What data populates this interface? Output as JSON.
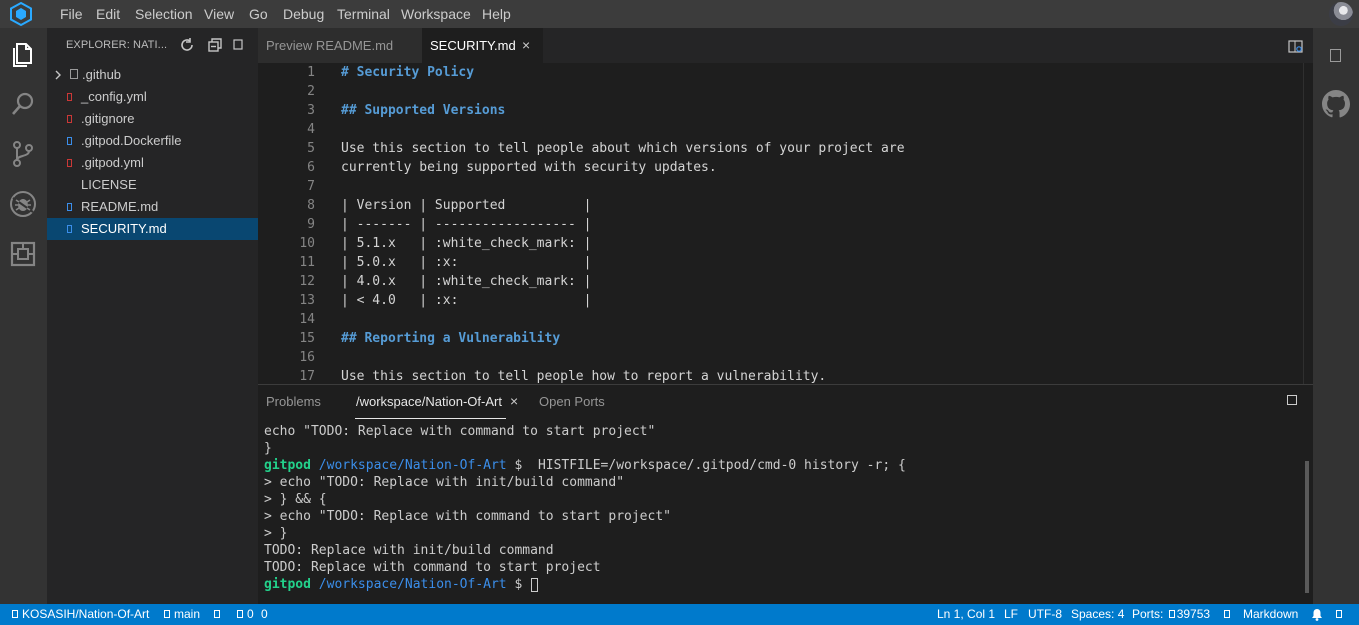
{
  "menu": [
    "File",
    "Edit",
    "Selection",
    "View",
    "Go",
    "Debug",
    "Terminal",
    "Workspace",
    "Help"
  ],
  "activity_icons": [
    "files-icon",
    "search-icon",
    "source-control-icon",
    "debug-icon",
    "extensions-icon"
  ],
  "explorer": {
    "title": "EXPLORER: NATI...",
    "items": [
      {
        "label": ".github",
        "type": "folder"
      },
      {
        "label": "_config.yml",
        "type": "file"
      },
      {
        "label": ".gitignore",
        "type": "file"
      },
      {
        "label": ".gitpod.Dockerfile",
        "type": "file"
      },
      {
        "label": ".gitpod.yml",
        "type": "file"
      },
      {
        "label": "LICENSE",
        "type": "file"
      },
      {
        "label": "README.md",
        "type": "file"
      },
      {
        "label": "SECURITY.md",
        "type": "file",
        "selected": true
      }
    ]
  },
  "tabs": [
    {
      "label": "Preview README.md",
      "active": false
    },
    {
      "label": "SECURITY.md",
      "active": true,
      "close": "×"
    }
  ],
  "editor": {
    "lines": [
      {
        "n": "1",
        "text": "# Security Policy",
        "heading": true
      },
      {
        "n": "2",
        "text": ""
      },
      {
        "n": "3",
        "text": "## Supported Versions",
        "heading": true
      },
      {
        "n": "4",
        "text": ""
      },
      {
        "n": "5",
        "text": "Use this section to tell people about which versions of your project are"
      },
      {
        "n": "6",
        "text": "currently being supported with security updates."
      },
      {
        "n": "7",
        "text": ""
      },
      {
        "n": "8",
        "text": "| Version | Supported          |"
      },
      {
        "n": "9",
        "text": "| ------- | ------------------ |"
      },
      {
        "n": "10",
        "text": "| 5.1.x   | :white_check_mark: |"
      },
      {
        "n": "11",
        "text": "| 5.0.x   | :x:                |"
      },
      {
        "n": "12",
        "text": "| 4.0.x   | :white_check_mark: |"
      },
      {
        "n": "13",
        "text": "| < 4.0   | :x:                |"
      },
      {
        "n": "14",
        "text": ""
      },
      {
        "n": "15",
        "text": "## Reporting a Vulnerability",
        "heading": true
      },
      {
        "n": "16",
        "text": ""
      },
      {
        "n": "17",
        "text": "Use this section to tell people how to report a vulnerability."
      }
    ]
  },
  "panel": {
    "tabs": [
      "Problems",
      "/workspace/Nation-Of-Art",
      "Open Ports"
    ],
    "close": "×"
  },
  "terminal": {
    "lines": [
      {
        "text": "echo \"TODO: Replace with command to start project\""
      },
      {
        "text": "}"
      },
      {
        "user": "gitpod",
        "path": "/workspace/Nation-Of-Art",
        "text": " $  HISTFILE=/workspace/.gitpod/cmd-0 history -r; {"
      },
      {
        "text": "> echo \"TODO: Replace with init/build command\""
      },
      {
        "text": "> } && {"
      },
      {
        "text": "> echo \"TODO: Replace with command to start project\""
      },
      {
        "text": "> }"
      },
      {
        "text": "TODO: Replace with init/build command"
      },
      {
        "text": "TODO: Replace with command to start project"
      },
      {
        "user": "gitpod",
        "path": "/workspace/Nation-Of-Art",
        "text": " $ "
      }
    ]
  },
  "status": {
    "repo": "KOSASIH/Nation-Of-Art",
    "branch": "main",
    "problems": "0",
    "warnings": "0",
    "position": "Ln 1, Col 1",
    "eol": "LF",
    "encoding": "UTF-8",
    "spaces": "Spaces: 4",
    "ports_label": "Ports:",
    "ports_value": "39753",
    "language": "Markdown"
  },
  "colors": {
    "statusbar": "#007acc",
    "selection": "#094771",
    "heading": "#569cd6",
    "prompt_user": "#23d18b",
    "prompt_path": "#3b8eea"
  }
}
